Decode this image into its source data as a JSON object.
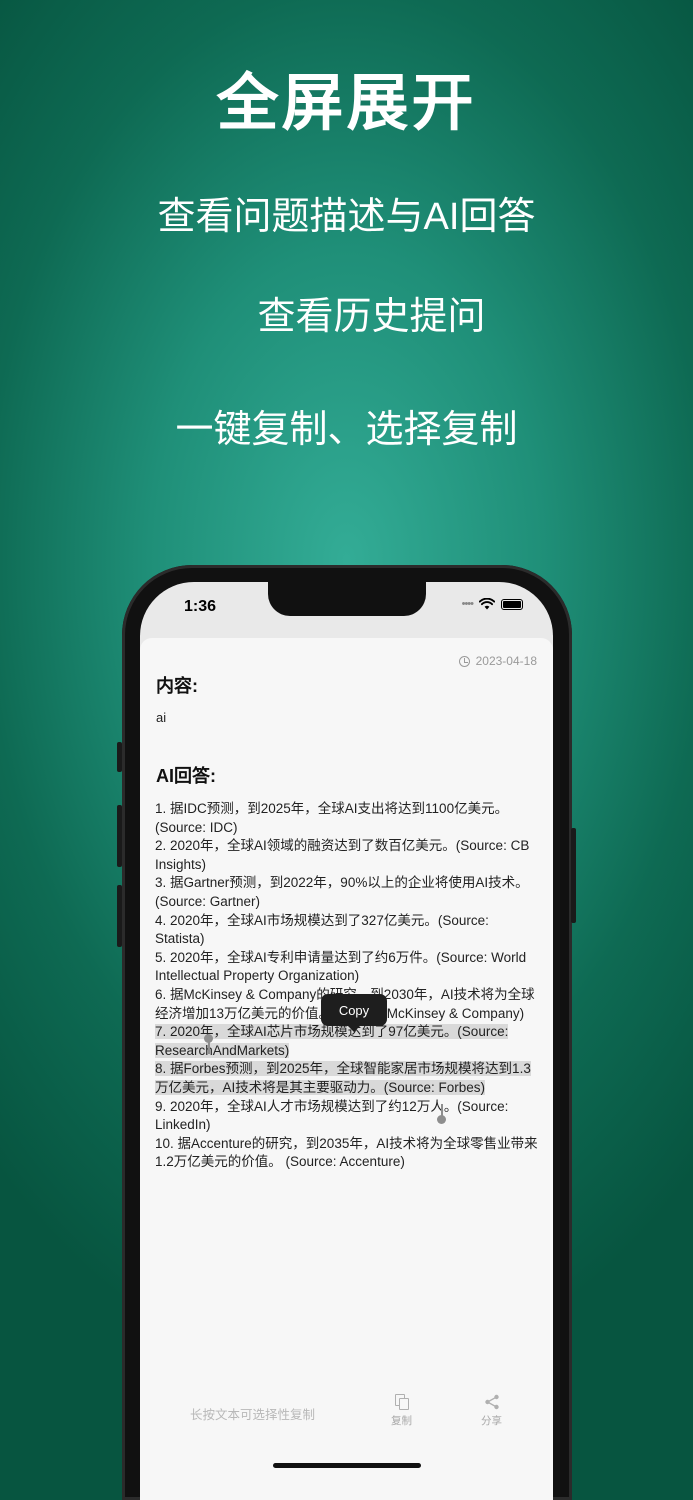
{
  "promo": {
    "title": "全屏展开",
    "line1": "查看问题描述与AI回答",
    "line2": "查看历史提问",
    "line3": "一键复制、选择复制"
  },
  "status_bar": {
    "time": "1:36"
  },
  "detail": {
    "date": "2023-04-18",
    "content_label": "内容:",
    "content_value": "ai",
    "answer_label": "AI回答:",
    "answer_items": [
      "1. 据IDC预测，到2025年，全球AI支出将达到1100亿美元。(Source: IDC)",
      "2. 2020年，全球AI领域的融资达到了数百亿美元。(Source: CB Insights)",
      "3. 据Gartner预测，到2022年，90%以上的企业将使用AI技术。 (Source: Gartner)",
      "4. 2020年，全球AI市场规模达到了327亿美元。(Source: Statista)",
      "5. 2020年，全球AI专利申请量达到了约6万件。(Source: World Intellectual Property Organization)",
      "6. 据McKinsey & Company的研究，到2030年，AI技术将为全球经济增加13万亿美元的价值。(Source: McKinsey & Company)",
      "7. 2020年，全球AI芯片市场规模达到了97亿美元。(Source: ResearchAndMarkets)",
      "8. 据Forbes预测，到2025年，全球智能家居市场规模将达到1.3万亿美元，AI技术将是其主要驱动力。(Source: Forbes)",
      "9. 2020年，全球AI人才市场规模达到了约12万人。(Source: LinkedIn)",
      "10. 据Accenture的研究，到2035年，AI技术将为全球零售业带来1.2万亿美元的价值。 (Source: Accenture)"
    ],
    "copy_tooltip": "Copy"
  },
  "bottom_bar": {
    "hint": "长按文本可选择性复制",
    "copy_label": "复制",
    "share_label": "分享"
  },
  "icons": [
    "clock-icon",
    "copy-icon",
    "share-icon",
    "wifi-icon",
    "battery-icon"
  ],
  "colors": {
    "background": "#0e6a53",
    "background_glow": "#33ac96",
    "selection": "#d9d9d9"
  }
}
